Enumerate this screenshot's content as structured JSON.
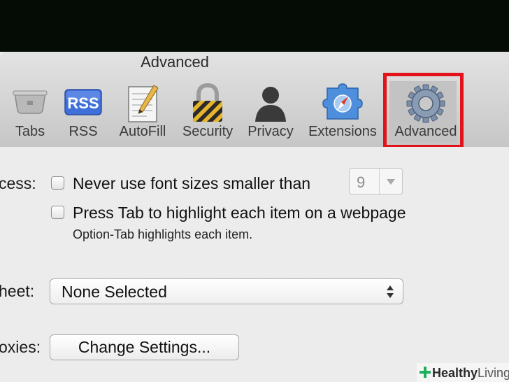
{
  "window": {
    "title": "Advanced"
  },
  "toolbar": {
    "items": [
      {
        "label": "Tabs",
        "icon": "tabs-icon"
      },
      {
        "label": "RSS",
        "icon": "rss-icon",
        "badge": "RSS"
      },
      {
        "label": "AutoFill",
        "icon": "autofill-icon"
      },
      {
        "label": "Security",
        "icon": "lock-icon"
      },
      {
        "label": "Privacy",
        "icon": "silhouette-icon"
      },
      {
        "label": "Extensions",
        "icon": "puzzle-compass-icon"
      },
      {
        "label": "Advanced",
        "icon": "gear-icon",
        "selected": true
      }
    ],
    "highlight_color": "#e3131b"
  },
  "settings": {
    "accessibility": {
      "label": "cess:",
      "min_font": {
        "text": "Never use font sizes smaller than",
        "checked": false,
        "value": "9"
      },
      "tab_highlight": {
        "text": "Press Tab to highlight each item on a webpage",
        "checked": false,
        "note": "Option-Tab highlights each item."
      }
    },
    "stylesheet": {
      "label": "heet:",
      "value": "None Selected"
    },
    "proxies": {
      "label": "oxies:",
      "button": "Change Settings..."
    }
  },
  "watermark": {
    "brand": "Healthy",
    "brand2": "Living",
    "color": "#1fae5b"
  }
}
